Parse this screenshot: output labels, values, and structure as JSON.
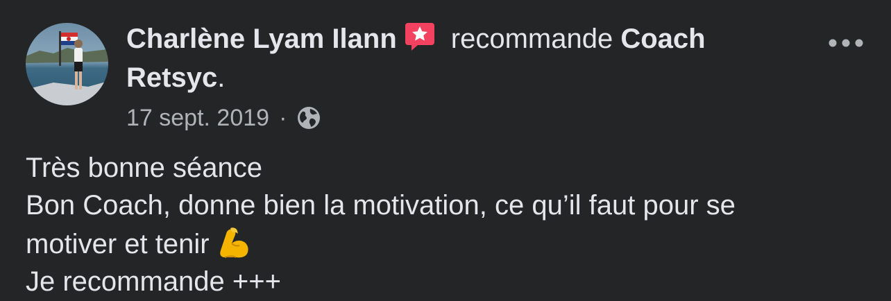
{
  "post": {
    "author": "Charlène Lyam Ilann",
    "action": "recommande",
    "page_name": "Coach Retsyc",
    "page_name_line1": "Coach",
    "page_name_line2": "Retsyc",
    "period": ".",
    "date": "17 sept. 2019",
    "separator": "·",
    "privacy_icon": "globe-icon",
    "recommend_icon": "recommend-star-icon",
    "more_icon": "more-dots-icon",
    "body_lines": [
      "Très bonne séance",
      "Bon Coach, donne bien la motivation, ce qu’il faut pour se",
      "motiver et tenir",
      "Je recommande +++"
    ],
    "body_emoji": "flexed-biceps-emoji"
  },
  "colors": {
    "background": "#242526",
    "primary_text": "#e4e6eb",
    "secondary_text": "#b0b3b8",
    "recommend_badge": "#f3425f"
  }
}
